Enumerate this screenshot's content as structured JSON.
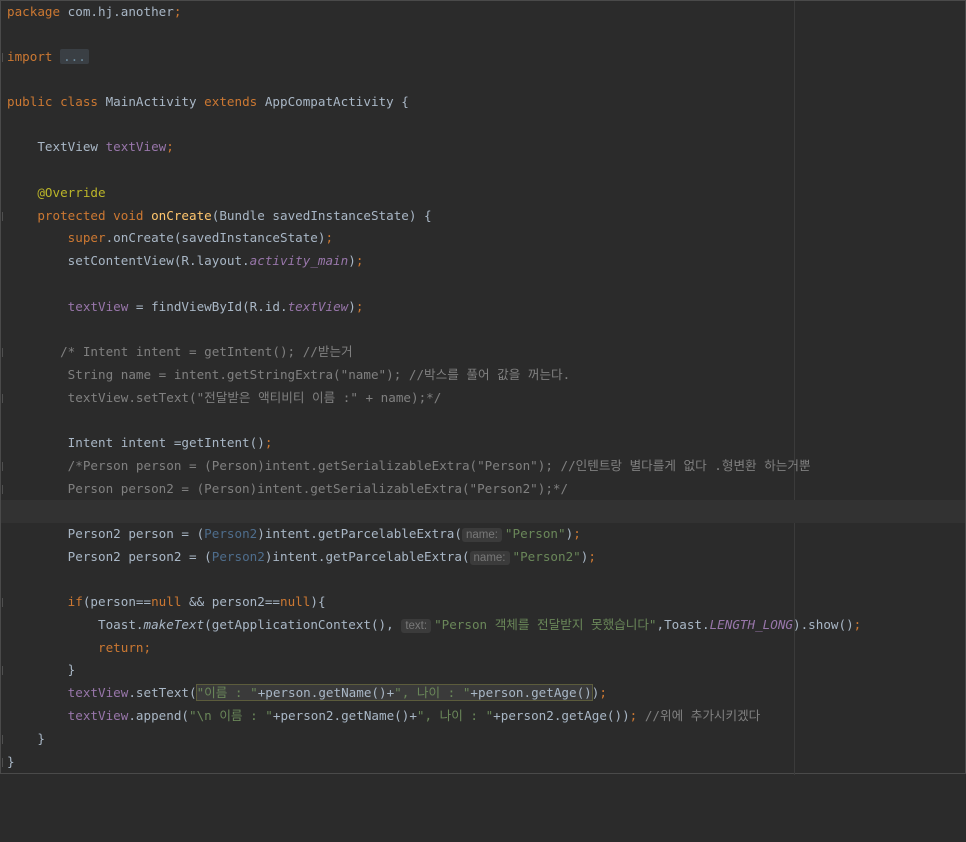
{
  "code": {
    "package_kw": "package",
    "package_name": " com.hj.another",
    "import_kw": "import",
    "import_fold": "...",
    "class_mods": "public class",
    "class_name": " MainActivity ",
    "extends_kw": "extends",
    "super_class": " AppCompatActivity {",
    "field_type": "TextView ",
    "field_name": "textView",
    "annotation": "@Override",
    "method_mods": "protected void ",
    "method_name": "onCreate",
    "method_params": "(Bundle savedInstanceState) {",
    "super_call_kw": "super",
    "super_call_rest": ".onCreate(savedInstanceState)",
    "set_content": "setContentView(R.layout.",
    "layout_name": "activity_main",
    "tv_assign_pre": " = findViewById(R.id.",
    "tv_id": "textView",
    "c1": "/* Intent intent = getIntent(); //받는거",
    "c2": "String name = intent.getStringExtra(\"name\"); //박스를 풀어 값을 꺼는다.",
    "c3": "textView.setText(\"전달받은 액티비티 이름 :\" + name);*/",
    "intent_line": "Intent intent =getIntent()",
    "c4": "/*Person person = (Person)intent.getSerializableExtra(\"Person\"); //인텐트랑 별다를게 없다 .형변환 하는거뿐",
    "c5": "Person person2 = (Person)intent.getSerializableExtra(\"Person2\");*/",
    "p1_pre": "Person2 person = (",
    "p1_cast": "Person2",
    "p1_mid": ")intent.getParcelableExtra(",
    "hint_name": "name:",
    "p1_str": "\"Person\"",
    "p2_pre": "Person2 person2 = (",
    "p2_cast": "Person2",
    "p2_mid": ")intent.getParcelableExtra(",
    "p2_str": "\"Person2\"",
    "if_kw": "if",
    "if_a": "(person==",
    "null_kw": "null",
    "if_b": " && person2==",
    "if_c": "){",
    "toast_pre": "Toast.",
    "toast_method": "makeText",
    "toast_mid": "(getApplicationContext(),",
    "hint_text": "text:",
    "toast_str": "\"Person 객체를 전달받지 못했습니다\"",
    "toast_b": ",Toast.",
    "toast_const": "LENGTH_LONG",
    "toast_end": ").show()",
    "return_kw": "return",
    "close_brace": "}",
    "st_field": "textView",
    "st_call": ".setText(",
    "st_s1": "\"이름 : \"",
    "st_m1": "+person.getName()+",
    "st_s2": "\", 나이 : \"",
    "st_m2": "+person.getAge()",
    "st_end": ")",
    "ap_field": "textView",
    "ap_call": ".append(",
    "ap_s1": "\"\\n 이름 : \"",
    "ap_m1": "+person2.getName()+",
    "ap_s2": "\", 나이 : \"",
    "ap_m2": "+person2.getAge())",
    "ap_com": " //위에 추가시키겠다",
    "semi": ";"
  }
}
